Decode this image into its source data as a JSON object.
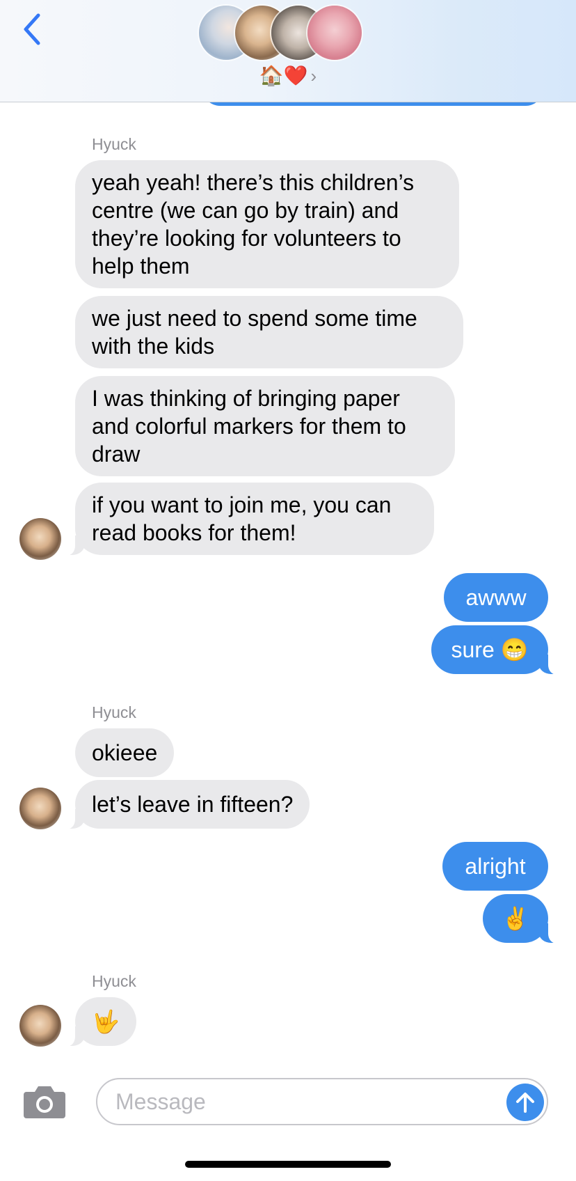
{
  "header": {
    "group_title": "🏠❤️",
    "chevron": "›",
    "back_icon": "chevron-left-icon",
    "avatars": [
      "avatar-1",
      "avatar-2",
      "avatar-3",
      "avatar-4"
    ]
  },
  "messages": {
    "group1": {
      "sender": "Hyuck",
      "bubbles": [
        "yeah yeah! there’s this children’s centre (we can go by train) and they’re looking for volunteers to help them",
        "we just need to spend some time with the kids",
        "I was thinking of bringing paper and colorful markers for them to draw",
        "if you want to join me, you can read books for them!"
      ]
    },
    "me1": {
      "bubbles": [
        "awww",
        "sure 😁"
      ]
    },
    "group2": {
      "sender": "Hyuck",
      "bubbles": [
        "okieee",
        "let’s leave in fifteen?"
      ]
    },
    "me2": {
      "bubbles": [
        "alright",
        "✌️"
      ]
    },
    "group3": {
      "sender": "Hyuck",
      "bubbles": [
        "🤟"
      ]
    }
  },
  "composer": {
    "placeholder": "Message",
    "value": "",
    "camera_icon": "camera-icon",
    "send_icon": "arrow-up-icon"
  },
  "colors": {
    "accent": "#3d8eec",
    "incoming_bubble": "#e9e9eb",
    "label_gray": "#8e8e93"
  }
}
